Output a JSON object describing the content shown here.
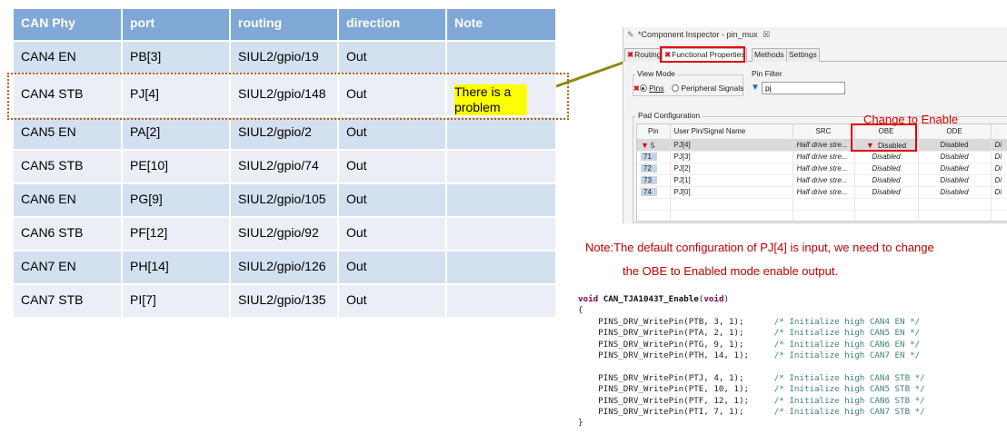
{
  "pin_table": {
    "headers": [
      "CAN Phy",
      "port",
      "routing",
      "direction",
      "Note"
    ],
    "rows": [
      {
        "phy": "CAN4 EN",
        "port": "PB[3]",
        "routing": "SIUL2/gpio/19",
        "direction": "Out",
        "note": ""
      },
      {
        "phy": "CAN4 STB",
        "port": "PJ[4]",
        "routing": "SIUL2/gpio/148",
        "direction": "Out",
        "note": "There is a problem"
      },
      {
        "phy": "CAN5 EN",
        "port": "PA[2]",
        "routing": "SIUL2/gpio/2",
        "direction": "Out",
        "note": ""
      },
      {
        "phy": "CAN5 STB",
        "port": "PE[10]",
        "routing": "SIUL2/gpio/74",
        "direction": "Out",
        "note": ""
      },
      {
        "phy": "CAN6 EN",
        "port": "PG[9]",
        "routing": "SIUL2/gpio/105",
        "direction": "Out",
        "note": ""
      },
      {
        "phy": "CAN6 STB",
        "port": "PF[12]",
        "routing": "SIUL2/gpio/92",
        "direction": "Out",
        "note": ""
      },
      {
        "phy": "CAN7 EN",
        "port": "PH[14]",
        "routing": "SIUL2/gpio/126",
        "direction": "Out",
        "note": ""
      },
      {
        "phy": "CAN7 STB",
        "port": "PI[7]",
        "routing": "SIUL2/gpio/135",
        "direction": "Out",
        "note": ""
      }
    ],
    "highlight_color": "#ffff00",
    "header_color": "#7fa8d7"
  },
  "inspector": {
    "title": "*Component Inspector - pin_mux",
    "close_glyph": "☒",
    "tabs": [
      {
        "label": "Routing",
        "error": true
      },
      {
        "label": "Functional Properties",
        "error": true
      },
      {
        "label": "Methods",
        "error": false
      },
      {
        "label": "Settings",
        "error": false
      }
    ],
    "view_mode": {
      "label": "View Mode",
      "options": [
        "Pins",
        "Peripheral Signals"
      ],
      "selected": "Pins"
    },
    "pin_filter": {
      "label": "Pin Filter",
      "value": "pj"
    },
    "pad_configuration": {
      "label": "Pad Configuration",
      "columns": [
        "Pin",
        "User Pin/Signal Name",
        "SRC",
        "OBE",
        "ODE",
        "S"
      ],
      "rows": [
        {
          "pin": "5",
          "name": "PJ[4]",
          "src": "Half drive stre...",
          "obe": "Disabled",
          "ode": "Disabled",
          "s": "Di",
          "selected": true,
          "flag": true
        },
        {
          "pin": "71",
          "name": "PJ[3]",
          "src": "Half drive stre...",
          "obe": "Disabled",
          "ode": "Disabled",
          "s": "Di",
          "selected": false,
          "flag": false
        },
        {
          "pin": "72",
          "name": "PJ[2]",
          "src": "Half drive stre...",
          "obe": "Disabled",
          "ode": "Disabled",
          "s": "Di",
          "selected": false,
          "flag": false
        },
        {
          "pin": "73",
          "name": "PJ[1]",
          "src": "Half drive stre...",
          "obe": "Disabled",
          "ode": "Disabled",
          "s": "Di",
          "selected": false,
          "flag": false
        },
        {
          "pin": "74",
          "name": "PJ[0]",
          "src": "Half drive stre...",
          "obe": "Disabled",
          "ode": "Disabled",
          "s": "Di",
          "selected": false,
          "flag": false
        }
      ]
    },
    "annotation": "Change to Enable",
    "annotation_color": "#e00000"
  },
  "note": {
    "line1": "Note:The default configuration of PJ[4] is input, we need to change",
    "line2": "the OBE to Enabled mode enable output.",
    "color": "#c00000"
  },
  "code": {
    "signature_kw": "void",
    "signature_name": "CAN_TJA1043T_Enable",
    "signature_arg": "void",
    "open_brace": "{",
    "close_brace": "}",
    "group1": [
      {
        "call": "PINS_DRV_WritePin(PTB, 3, 1);",
        "comment": "/* Initialize high CAN4 EN */"
      },
      {
        "call": "PINS_DRV_WritePin(PTA, 2, 1);",
        "comment": "/* Initialize high CAN5 EN */"
      },
      {
        "call": "PINS_DRV_WritePin(PTG, 9, 1);",
        "comment": "/* Initialize high CAN6 EN */"
      },
      {
        "call": "PINS_DRV_WritePin(PTH, 14, 1);",
        "comment": "/* Initialize high CAN7 EN */"
      }
    ],
    "group2": [
      {
        "call": "PINS_DRV_WritePin(PTJ, 4, 1);",
        "comment": "/* Initialize high CAN4 STB */"
      },
      {
        "call": "PINS_DRV_WritePin(PTE, 10, 1);",
        "comment": "/* Initialize high CAN5 STB */"
      },
      {
        "call": "PINS_DRV_WritePin(PTF, 12, 1);",
        "comment": "/* Initialize high CAN6 STB */"
      },
      {
        "call": "PINS_DRV_WritePin(PTI, 7, 1);",
        "comment": "/* Initialize high CAN7 STB */"
      }
    ]
  }
}
